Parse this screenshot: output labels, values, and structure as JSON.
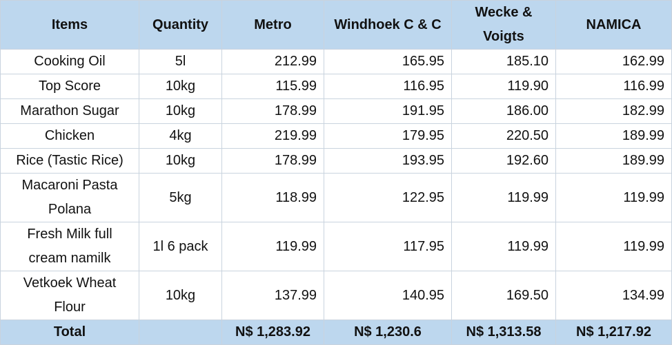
{
  "columns": [
    "Items",
    "Quantity",
    "Metro",
    "Windhoek C & C",
    "Wecke & Voigts",
    "NAMICA"
  ],
  "rows": [
    {
      "item": "Cooking Oil",
      "qty": "5l",
      "prices": [
        "212.99",
        "165.95",
        "185.10",
        "162.99"
      ]
    },
    {
      "item": "Top Score",
      "qty": "10kg",
      "prices": [
        "115.99",
        "116.95",
        "119.90",
        "116.99"
      ]
    },
    {
      "item": "Marathon Sugar",
      "qty": "10kg",
      "prices": [
        "178.99",
        "191.95",
        "186.00",
        "182.99"
      ]
    },
    {
      "item": "Chicken",
      "qty": "4kg",
      "prices": [
        "219.99",
        "179.95",
        "220.50",
        "189.99"
      ]
    },
    {
      "item": "Rice (Tastic Rice)",
      "qty": "10kg",
      "prices": [
        "178.99",
        "193.95",
        "192.60",
        "189.99"
      ]
    },
    {
      "item": "Macaroni Pasta Polana",
      "qty": "5kg",
      "prices": [
        "118.99",
        "122.95",
        "119.99",
        "119.99"
      ]
    },
    {
      "item": "Fresh Milk full cream namilk",
      "qty": "1l 6 pack",
      "prices": [
        "119.99",
        "117.95",
        "119.99",
        "119.99"
      ]
    },
    {
      "item": "Vetkoek Wheat Flour",
      "qty": "10kg",
      "prices": [
        "137.99",
        "140.95",
        "169.50",
        "134.99"
      ]
    }
  ],
  "total": {
    "label": "Total",
    "values": [
      "N$ 1,283.92",
      "N$ 1,230.6",
      "N$ 1,313.58",
      "N$ 1,217.92"
    ]
  }
}
